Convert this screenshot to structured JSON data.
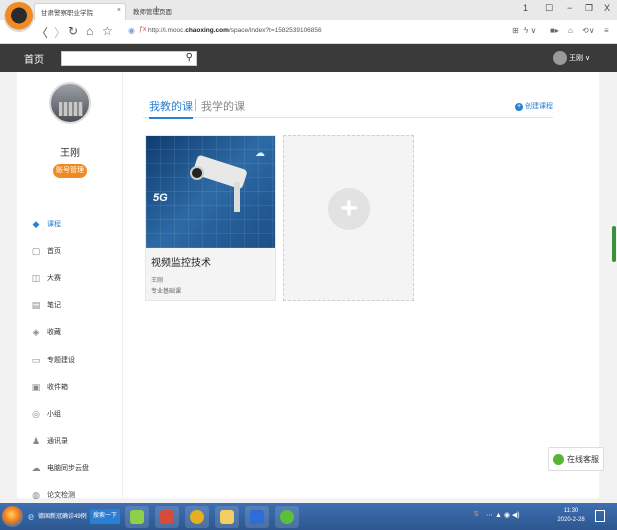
{
  "browser": {
    "tabs": [
      {
        "label": "甘肃警察职业学院",
        "close": "×"
      },
      {
        "label": "教师管理页面"
      }
    ],
    "new_tab": "+",
    "window_controls": [
      "1",
      "☐",
      "−",
      "❐",
      "X"
    ],
    "url_prefix": "http://i.mooc.",
    "url_domain": "chaoxing.com",
    "url_suffix": "/space/index?t=1582539106856",
    "cert_mark": "f\\u0078",
    "right_icons": [
      "⊞",
      "ϟ ∨",
      "■▸",
      "⌂",
      "⟲∨",
      "≡"
    ]
  },
  "site": {
    "home_label": "首页",
    "search_placeholder": "",
    "user_label": "王刚 ∨"
  },
  "profile": {
    "name": "王刚",
    "account_button": "账号管理"
  },
  "menu": [
    {
      "label": "课程",
      "icon": "◆",
      "active": true
    },
    {
      "label": "首页",
      "icon": "▢"
    },
    {
      "label": "大赛",
      "icon": "◫"
    },
    {
      "label": "笔记",
      "icon": "▤"
    },
    {
      "label": "收藏",
      "icon": "◈"
    },
    {
      "label": "专题建设",
      "icon": "▭"
    },
    {
      "label": "收件箱",
      "icon": "▣"
    },
    {
      "label": "小组",
      "icon": "◎"
    },
    {
      "label": "通讯录",
      "icon": "♟"
    },
    {
      "label": "电脑同步云盘",
      "icon": "☁"
    },
    {
      "label": "论文检测",
      "icon": "◍"
    }
  ],
  "tabs": {
    "teaching": "我教的课",
    "learning": "我学的课",
    "create": "创建课程"
  },
  "course": {
    "title": "视频监控技术",
    "teacher": "王刚",
    "type": "专业基础课",
    "cover_badge": "5G"
  },
  "add_card": {
    "symbol": "+"
  },
  "online_service": "在线客服",
  "taskbar": {
    "ie_label": "德国新冠确诊49例",
    "search_label": "搜索一下",
    "tray_text": "S",
    "time": "11:30",
    "date": "2020-2-28"
  }
}
